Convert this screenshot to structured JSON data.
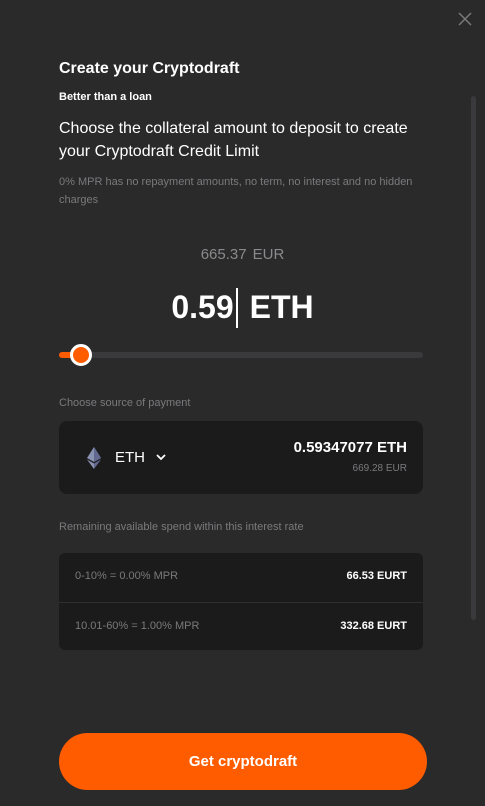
{
  "header": {
    "title": "Create your Cryptodraft",
    "subtitle": "Better than a loan",
    "heading": "Choose the collateral amount to deposit to create your Cryptodraft Credit Limit",
    "note": "0% MPR has no repayment amounts, no term, no interest and no hidden charges"
  },
  "amount": {
    "fiat_value": "665.37",
    "fiat_currency": "EUR",
    "value": "0.59",
    "currency": "ETH"
  },
  "slider": {
    "level_fraction": 0.045,
    "accent": "#ff5c00"
  },
  "source": {
    "label": "Choose source of payment",
    "asset": "ETH",
    "asset_icon": "ethereum-icon",
    "balance": "0.59347077 ETH",
    "balance_fiat": "669.28 EUR"
  },
  "rates": {
    "label": "Remaining available spend within this interest rate",
    "rows": [
      {
        "range": "0-10% = 0.00% MPR",
        "value": "66.53 EURT"
      },
      {
        "range": "10.01-60% = 1.00% MPR",
        "value": "332.68 EURT"
      }
    ]
  },
  "cta": {
    "label": "Get cryptodraft"
  },
  "colors": {
    "background": "#2a2a2b",
    "card": "#1b1b1c",
    "accent": "#ff5c00",
    "muted_text": "#7a7a7c"
  }
}
